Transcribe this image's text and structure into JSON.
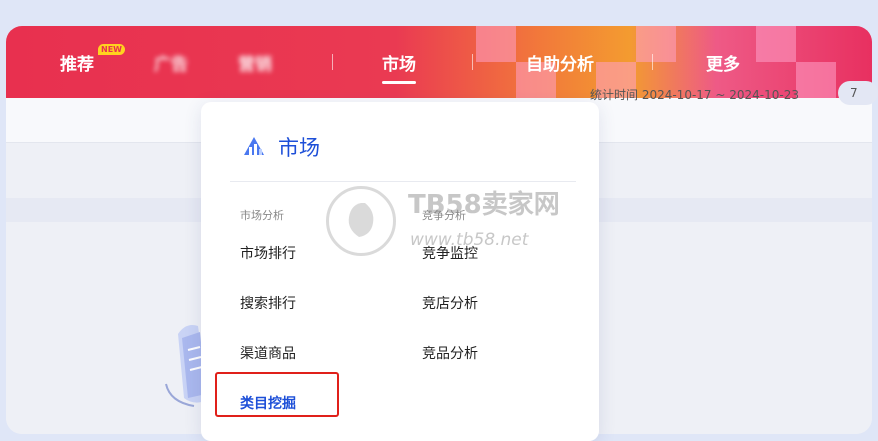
{
  "nav": {
    "items": [
      {
        "label": "推荐",
        "badge": "NEW"
      },
      {
        "label": "广告"
      },
      {
        "label": "营销"
      },
      {
        "label": "市场"
      },
      {
        "label": "自助分析"
      },
      {
        "label": "更多"
      }
    ],
    "active": "市场"
  },
  "subbar": {
    "stat_text": "统计时间 2024-10-17 ~ 2024-10-23",
    "pill_text": "7"
  },
  "menu": {
    "title": "市场",
    "left_group": "市场分析",
    "right_group": "竞争分析",
    "left_items": [
      "市场排行",
      "搜索排行",
      "渠道商品",
      "类目挖掘"
    ],
    "right_items": [
      "竞争监控",
      "竞店分析",
      "竞品分析"
    ],
    "selected": "类目挖掘"
  },
  "watermark": {
    "name": "TB58卖家网",
    "url": "www.tb58.net"
  },
  "colors": {
    "topbar_start": "#e8304f",
    "topbar_mid": "#f39b30",
    "accent_blue": "#1d4fd8",
    "highlight_red": "#e0201a"
  }
}
